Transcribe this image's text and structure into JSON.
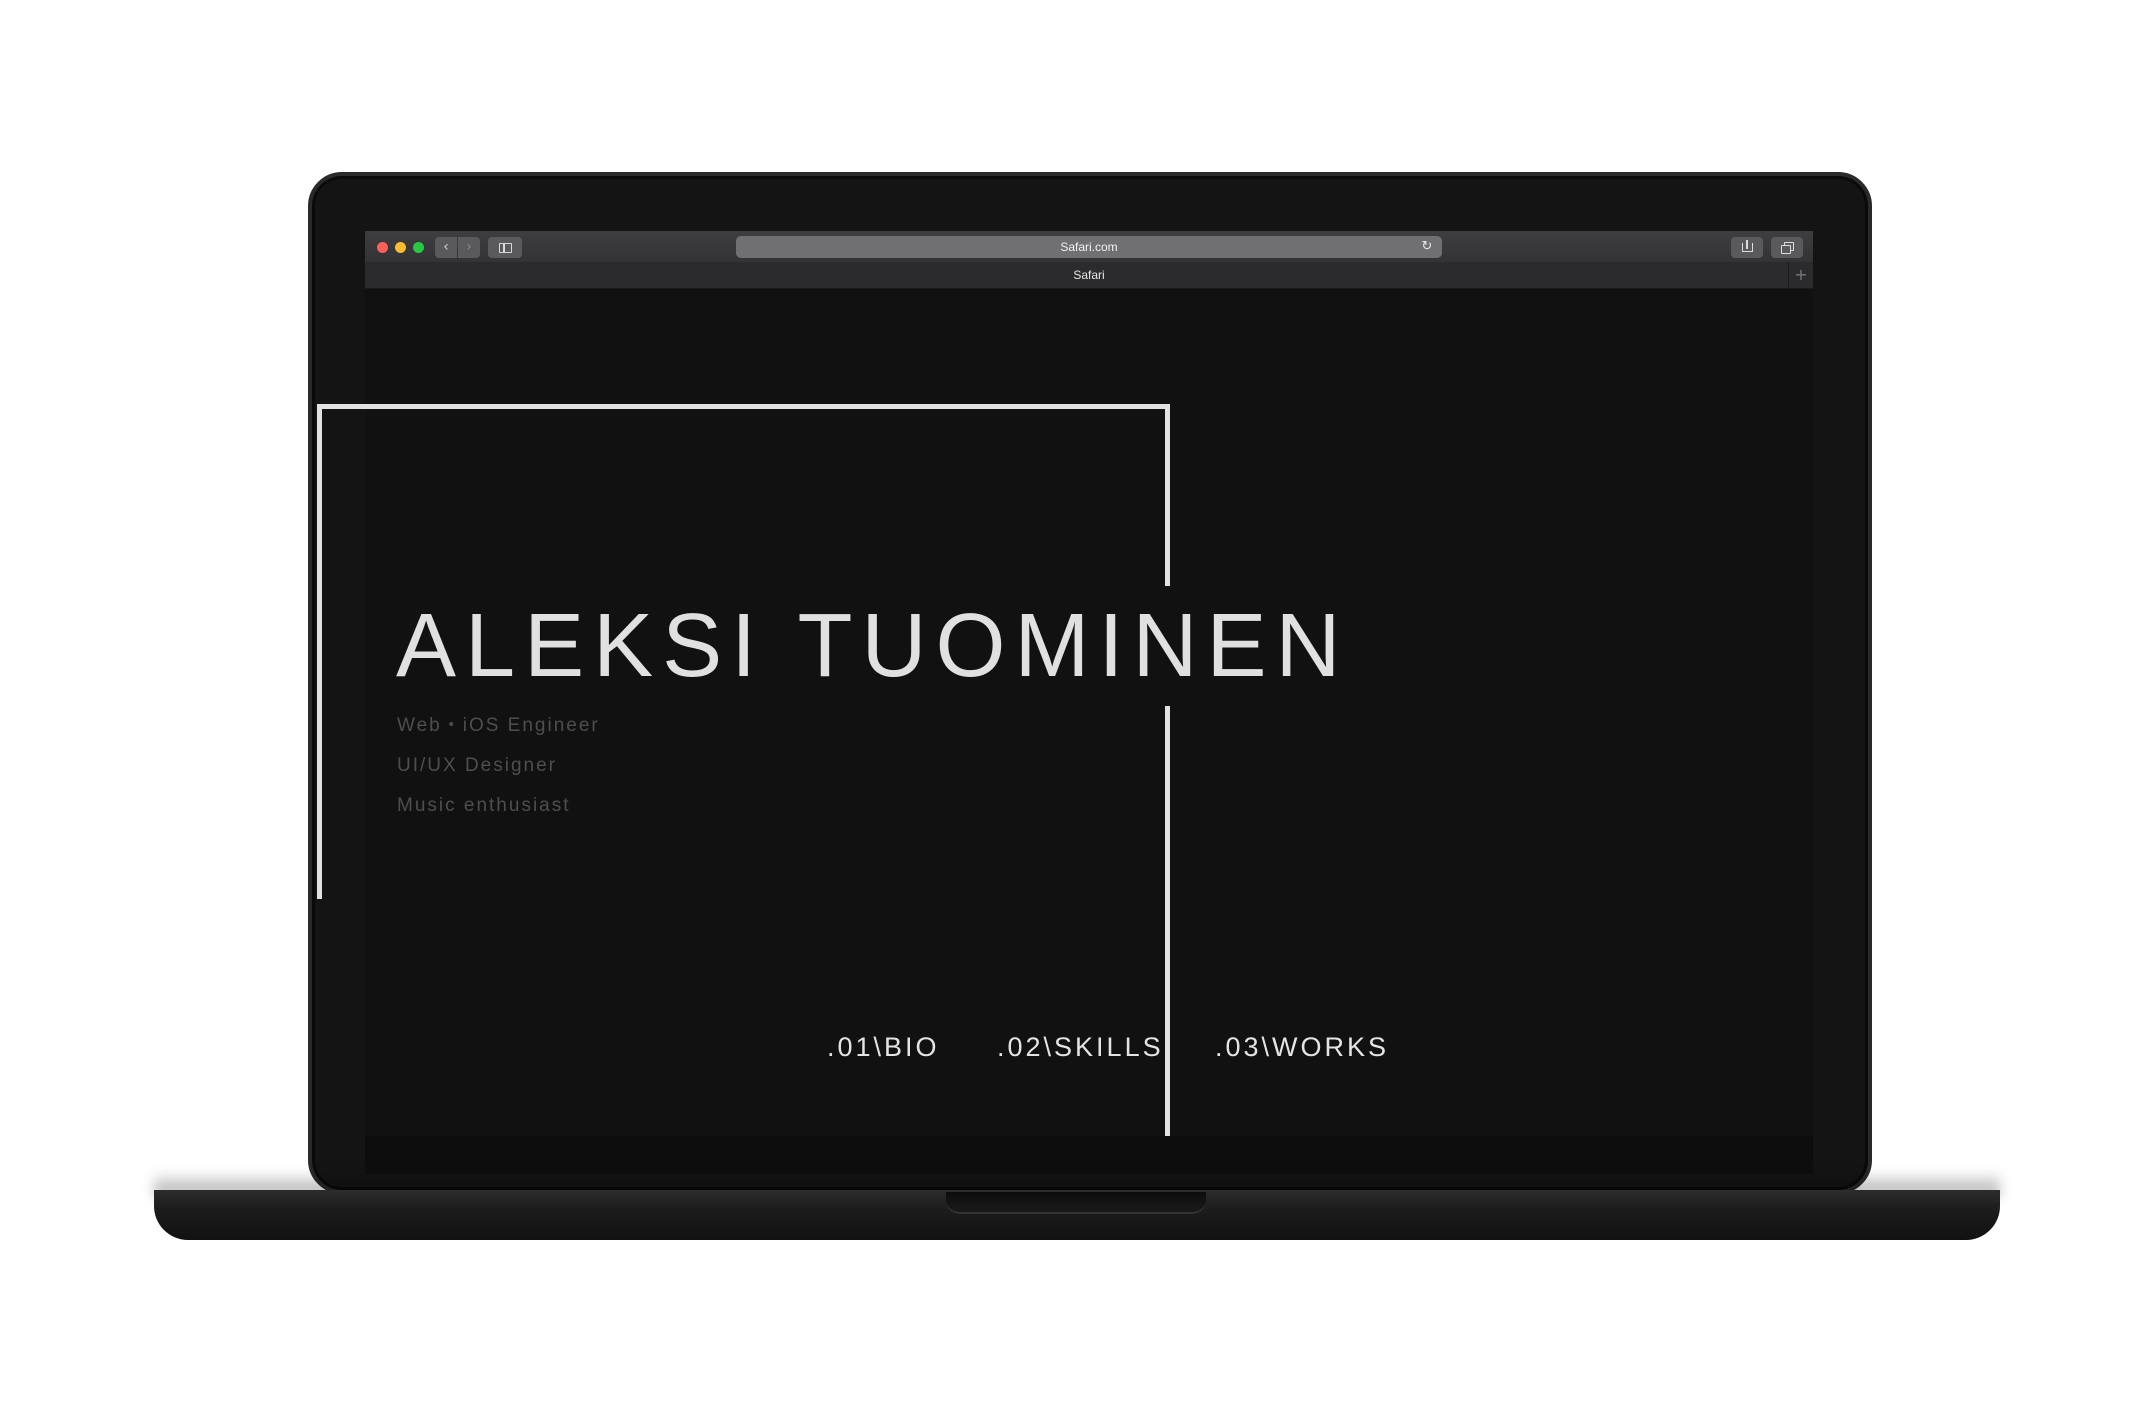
{
  "browser": {
    "url": "Safari.com",
    "tab_title": "Safari",
    "nav_back_glyph": "‹",
    "nav_forward_glyph": "›",
    "reload_glyph": "↻",
    "new_tab_glyph": "+",
    "traffic_lights": {
      "close": "#fe5f57",
      "minimize": "#febc2e",
      "maximize": "#28c840"
    }
  },
  "hero": {
    "name": "ALEKSI TUOMINEN",
    "taglines": [
      "Web・iOS Engineer",
      "UI/UX Designer",
      "Music enthusiast"
    ]
  },
  "nav": {
    "items": [
      ".01\\BIO",
      ".02\\SKILLS",
      ".03\\WORKS"
    ]
  },
  "theme": {
    "background": "#111111",
    "foreground": "#e2e2e2",
    "muted": "#4e4e4e"
  }
}
